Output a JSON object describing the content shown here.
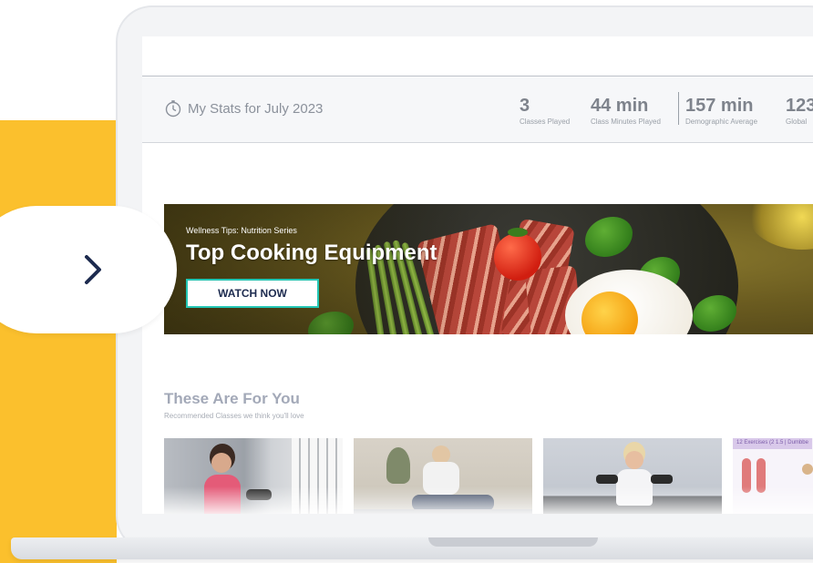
{
  "stats": {
    "title": "My Stats for July 2023",
    "items": [
      {
        "value": "3",
        "label": "Classes Played"
      },
      {
        "value": "44 min",
        "label": "Class Minutes Played"
      },
      {
        "value": "157 min",
        "label": "Demographic Average"
      },
      {
        "value": "123",
        "label": "Global"
      }
    ]
  },
  "banner": {
    "kicker": "Wellness Tips: Nutrition Series",
    "title": "Top Cooking Equipment",
    "cta": "WATCH NOW"
  },
  "recommendations": {
    "title": "These Are For You",
    "subtitle": "Recommended Classes we think you'll love",
    "cards": [
      {
        "tag": ""
      },
      {
        "tag": ""
      },
      {
        "tag": ""
      },
      {
        "tag": "12 Exercises (2 1.5 | Dumbbe"
      }
    ]
  },
  "colors": {
    "accent_yellow": "#fbc02d",
    "button_border": "#23c6b4",
    "arrow": "#1d2b4f"
  },
  "icons": {
    "stats_icon": "stopwatch-icon",
    "nav_arrow": "chevron-right-icon"
  }
}
